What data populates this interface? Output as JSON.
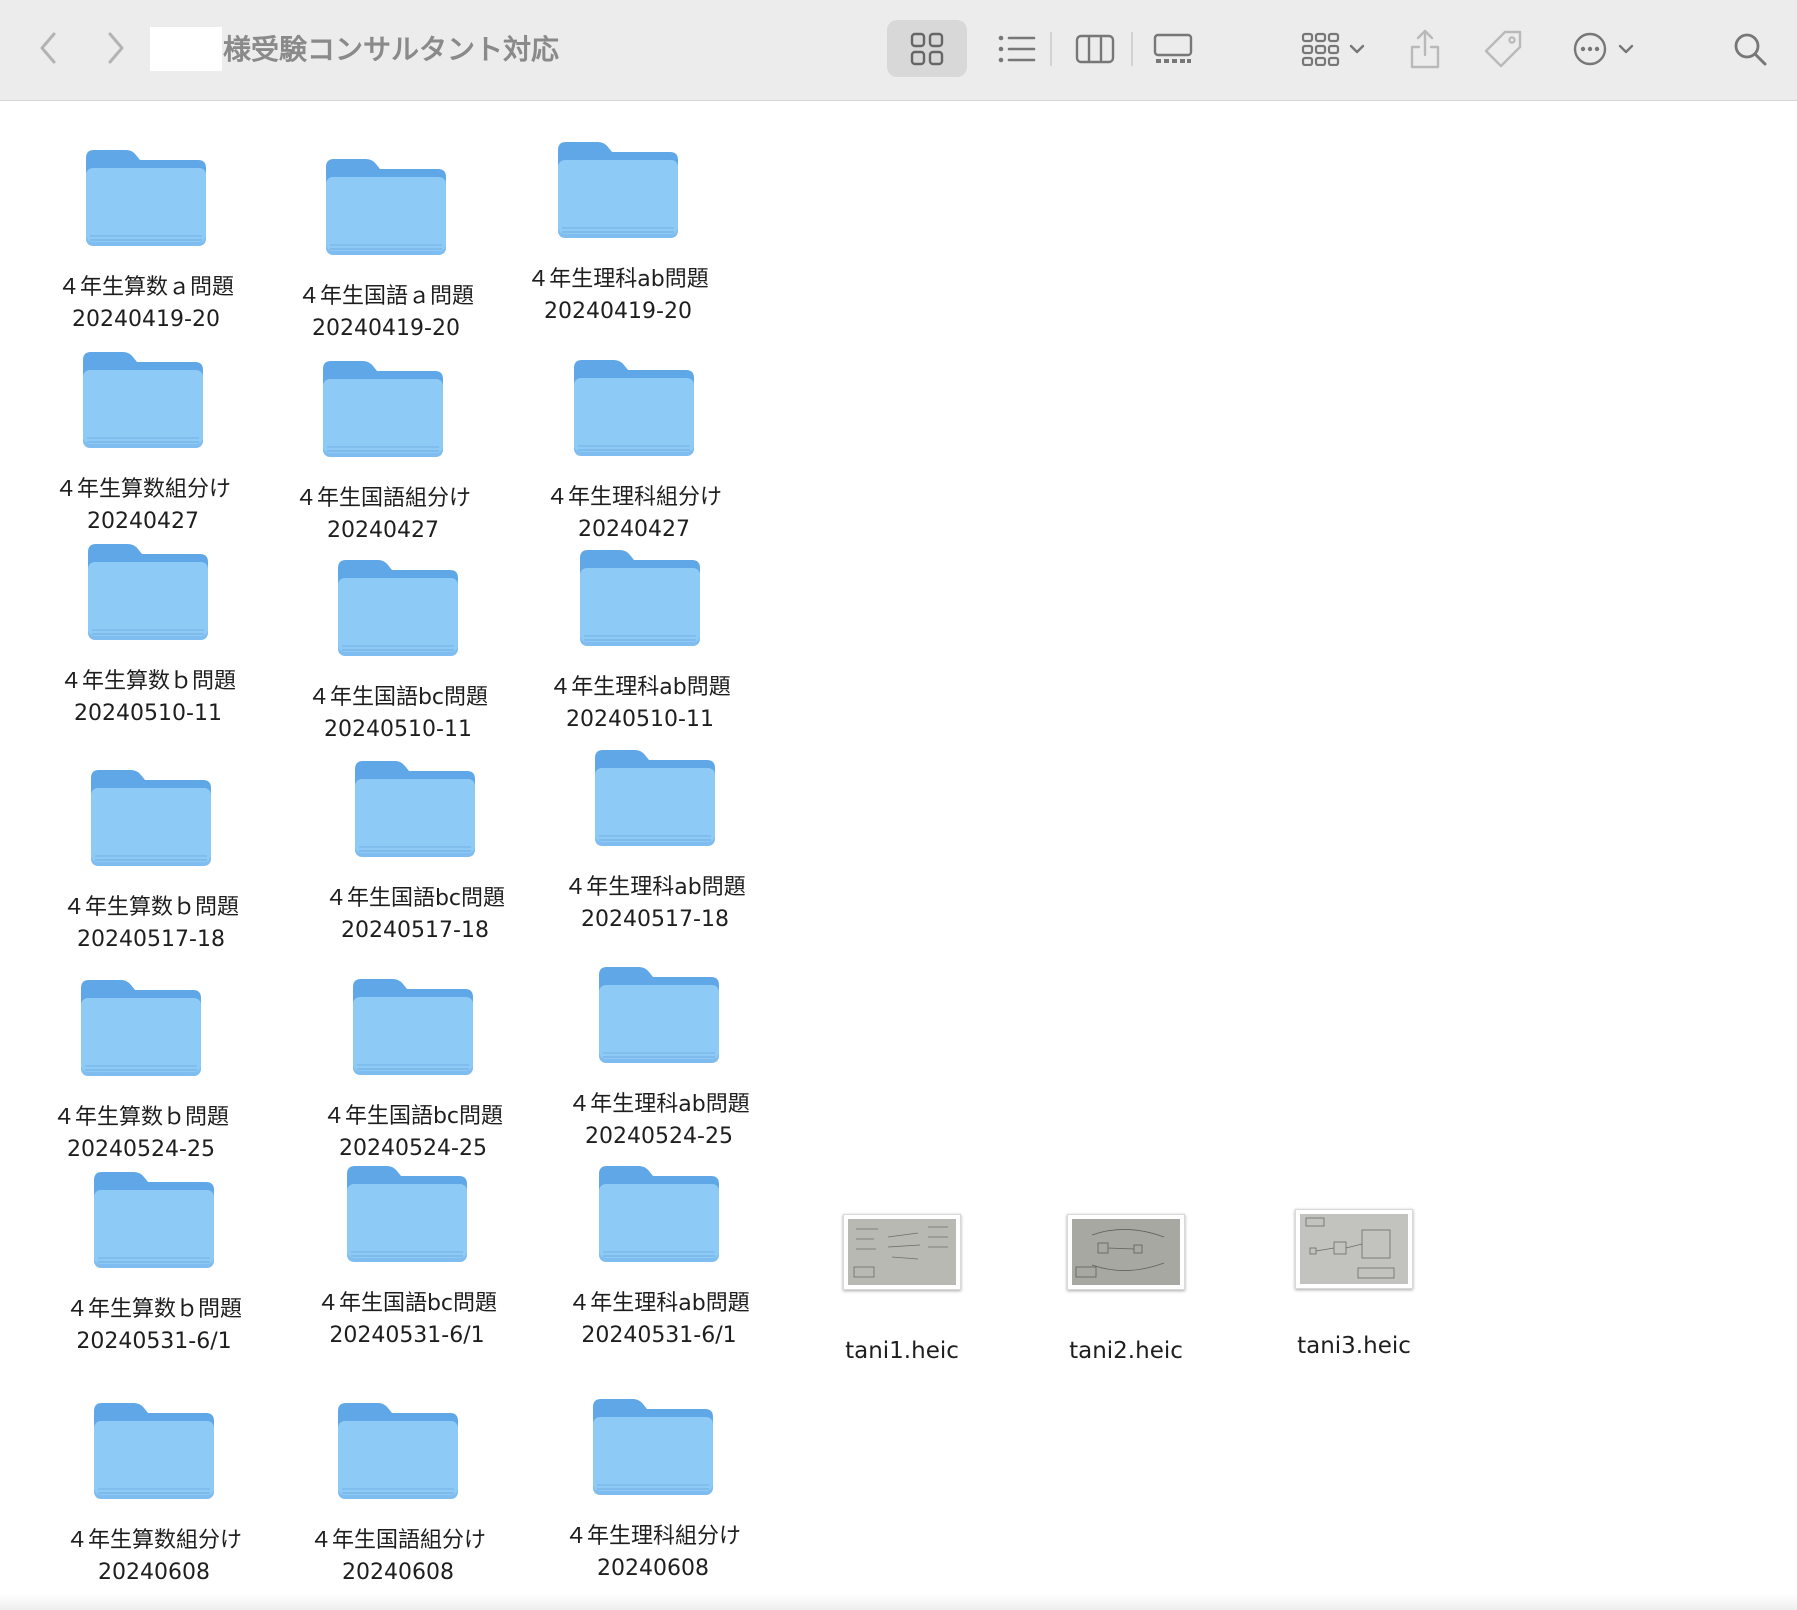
{
  "window": {
    "title": "様受験コンサルタント対応"
  },
  "toolbar": {
    "icons": {
      "back": "chevron-left-icon",
      "forward": "chevron-right-icon",
      "icon_view": "grid-icon",
      "list_view": "list-icon",
      "column_view": "columns-icon",
      "gallery_view": "gallery-icon",
      "group": "group-icon",
      "share": "share-icon",
      "tag": "tag-icon",
      "more": "ellipsis-circle-icon",
      "search": "search-icon"
    }
  },
  "folders": [
    {
      "line1": "４年生算数ａ問題",
      "line2": "20240419-20"
    },
    {
      "line1": "４年生国語ａ問題",
      "line2": "20240419-20"
    },
    {
      "line1": "４年生理科ab問題",
      "line2": "20240419-20"
    },
    {
      "line1": "４年生算数組分け",
      "line2": "20240427"
    },
    {
      "line1": "４年生国語組分け",
      "line2": "20240427"
    },
    {
      "line1": "４年生理科組分け",
      "line2": "20240427"
    },
    {
      "line1": "４年生算数ｂ問題",
      "line2": "20240510-11"
    },
    {
      "line1": "４年生国語bc問題",
      "line2": "20240510-11"
    },
    {
      "line1": "４年生理科ab問題",
      "line2": "20240510-11"
    },
    {
      "line1": "４年生算数ｂ問題",
      "line2": "20240517-18"
    },
    {
      "line1": "４年生国語bc問題",
      "line2": "20240517-18"
    },
    {
      "line1": "４年生理科ab問題",
      "line2": "20240517-18"
    },
    {
      "line1": "４年生算数ｂ問題",
      "line2": "20240524-25"
    },
    {
      "line1": "４年生国語bc問題",
      "line2": "20240524-25"
    },
    {
      "line1": "４年生理科ab問題",
      "line2": "20240524-25"
    },
    {
      "line1": "４年生算数ｂ問題",
      "line2": "20240531-6/1"
    },
    {
      "line1": "４年生国語bc問題",
      "line2": "20240531-6/1"
    },
    {
      "line1": "４年生理科ab問題",
      "line2": "20240531-6/1"
    },
    {
      "line1": "４年生算数組分け",
      "line2": "20240608"
    },
    {
      "line1": "４年生国語組分け",
      "line2": "20240608"
    },
    {
      "line1": "４年生理科組分け",
      "line2": "20240608"
    }
  ],
  "files": [
    {
      "name": "tani1.heic"
    },
    {
      "name": "tani2.heic"
    },
    {
      "name": "tani3.heic"
    }
  ],
  "colors": {
    "folder_body": "#8dcbf6",
    "folder_tab": "#5fa7e6",
    "toolbar_bg": "#ececec",
    "title_text": "#8a8a8a"
  }
}
